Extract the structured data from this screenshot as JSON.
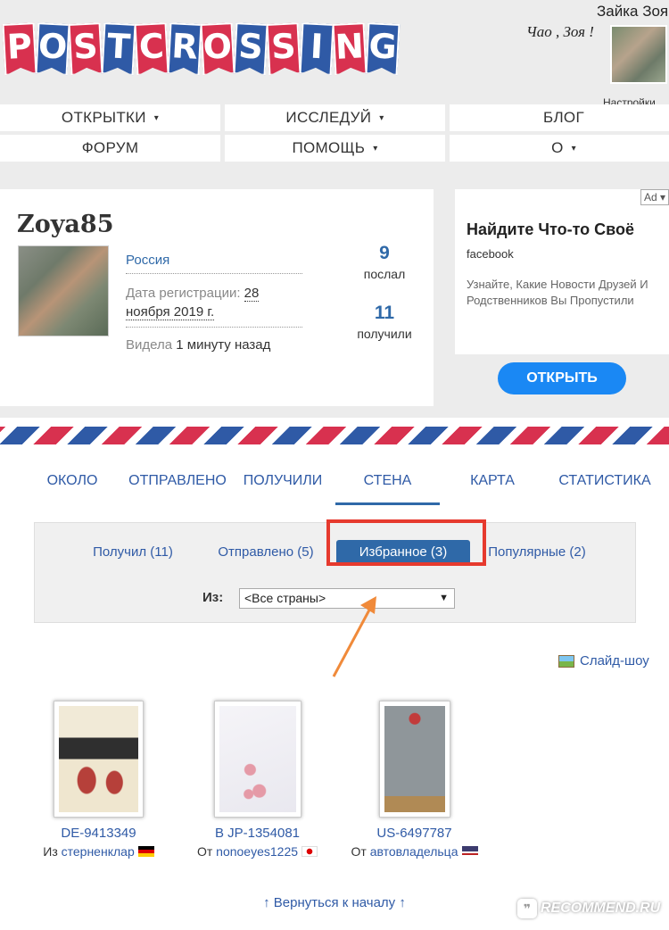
{
  "header": {
    "logo_letters": [
      "P",
      "O",
      "S",
      "T",
      "C",
      "R",
      "O",
      "S",
      "S",
      "I",
      "N",
      "G"
    ],
    "greeting": "Чао , Зоя !",
    "username": "Зайка Зоя",
    "settings_label": "Настройки"
  },
  "menu": [
    {
      "label": "ОТКРЫТКИ",
      "caret": "▾"
    },
    {
      "label": "ИССЛЕДУЙ",
      "caret": "▾"
    },
    {
      "label": "БЛОГ",
      "caret": ""
    },
    {
      "label": "ФОРУМ",
      "caret": ""
    },
    {
      "label": "ПОМОЩЬ",
      "caret": "▾"
    },
    {
      "label": "О",
      "caret": "▾"
    }
  ],
  "profile": {
    "name": "Zoya85",
    "country": "Россия",
    "registered_label": "Дата регистрации: ",
    "registered_value": "28 ноября 2019 г.",
    "seen_label": "Видела ",
    "seen_value": "1 минуту назад",
    "sent_count": "9",
    "sent_label": "послал",
    "received_count": "11",
    "received_label": "получили"
  },
  "ad": {
    "tag": "Ad ▾",
    "title": "Найдите Что-то Своё",
    "source": "facebook",
    "text": "Узнайте, Какие Новости Друзей И Родственников Вы Пропустили",
    "button": "ОТКРЫТЬ",
    "button_color": "#1a88f4"
  },
  "tabs": [
    "ОКОЛО",
    "ОТПРАВЛЕНО",
    "ПОЛУЧИЛИ",
    "СТЕНА",
    "КАРТА",
    "СТАТИСТИКА"
  ],
  "active_tab": "СТЕНА",
  "wall_filters": [
    "Получил (11)",
    "Отправлено (5)",
    "Избранное (3)",
    "Популярные (2)"
  ],
  "selected_filter": "Избранное (3)",
  "from_label": "Из:",
  "country_select": "<Все страны>",
  "slideshow": "Слайд-шоу",
  "postcards": [
    {
      "id": "DE-9413349",
      "from_label": "Из ",
      "user": "стерненклар",
      "flag": "de"
    },
    {
      "id": "В JP-1354081",
      "from_label": "От ",
      "user": "nonoeyes1225",
      "flag": "jp"
    },
    {
      "id": "US-6497787",
      "from_label": "От ",
      "user": "автовладельца",
      "flag": "us"
    }
  ],
  "back_to_top": "↑ Вернуться к началу ↑",
  "watermark": "RECOMMEND.RU",
  "colors": {
    "brand_red": "#d8314f",
    "brand_blue": "#2f5aa6",
    "link": "#2f69a8",
    "highlight_box": "#e63a2e",
    "arrow": "#f08a3a"
  }
}
